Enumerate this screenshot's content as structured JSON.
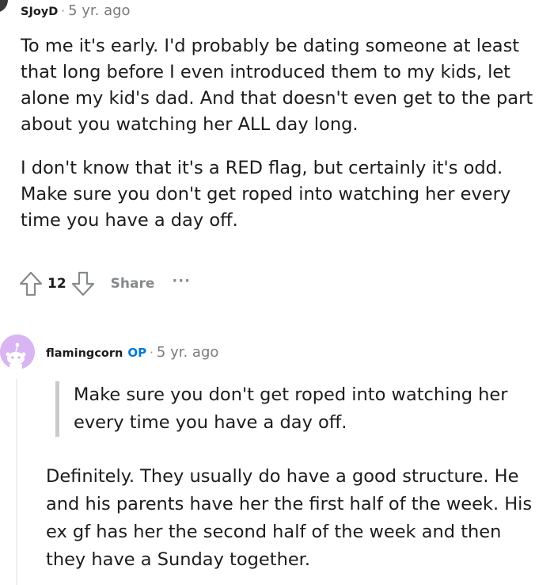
{
  "comment1": {
    "author": "SJoyD",
    "separator": "·",
    "age": "5 yr. ago",
    "paragraphs": [
      "To me it's early. I'd probably be dating someone at least that long before I even introduced them to my kids, let alone my kid's dad. And that doesn't even get to the part about you watching her ALL day long.",
      "I don't know that it's a RED flag, but certainly it's odd. Make sure you don't get roped into watching her every time you have a day off."
    ],
    "score": "12",
    "share_label": "Share",
    "more_label": "···",
    "icons": {
      "upvote": "upvote-arrow-icon",
      "downvote": "downvote-arrow-icon",
      "more": "more-options-icon"
    }
  },
  "comment2": {
    "author": "flamingcorn",
    "op_badge": "OP",
    "separator": "·",
    "age": "5 yr. ago",
    "quote": "Make sure you don't get roped into watching her every time you have a day off.",
    "body": "Definitely. They usually do have a good structure. He and his parents have her the first half of the week. His ex gf has her the second half of the week and then they have a Sunday together.",
    "avatar_color": "#d9b5f3"
  },
  "colors": {
    "text": "#1c1c1c",
    "meta": "#787c7e",
    "action": "#878a8c",
    "op_blue": "#0079d3",
    "quote_bar": "#c8cacc"
  }
}
